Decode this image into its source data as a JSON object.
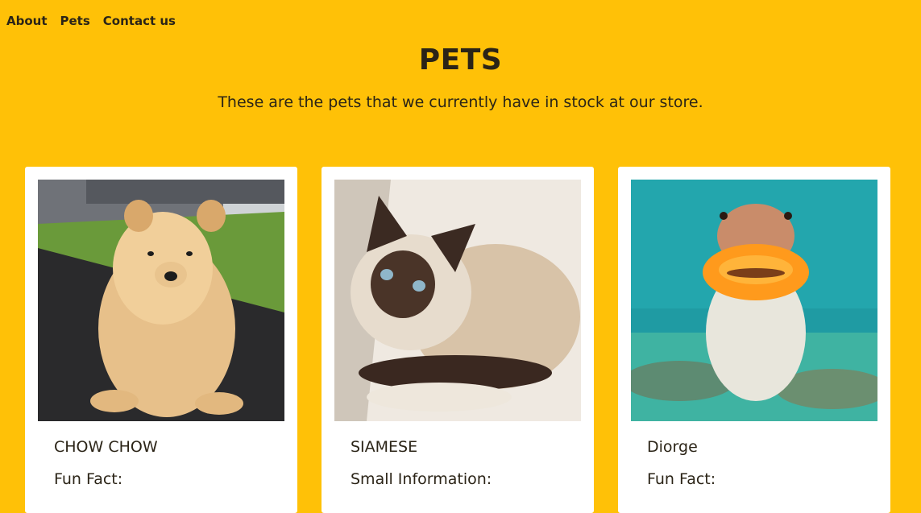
{
  "nav": {
    "items": [
      {
        "label": "About"
      },
      {
        "label": "Pets"
      },
      {
        "label": "Contact us"
      }
    ]
  },
  "header": {
    "title": "PETS",
    "subtitle": "These are the pets that we currently have in stock at our store."
  },
  "cards": [
    {
      "name": "CHOW CHOW",
      "fact_label": "Fun Fact:",
      "image": "chow-chow-puppy"
    },
    {
      "name": "SIAMESE",
      "fact_label": "Small Information:",
      "image": "siamese-cat"
    },
    {
      "name": "Diorge",
      "fact_label": "Fun Fact:",
      "image": "fish-underwater"
    }
  ],
  "colors": {
    "background": "#ffc107",
    "card": "#ffffff",
    "text": "#2b2417"
  }
}
